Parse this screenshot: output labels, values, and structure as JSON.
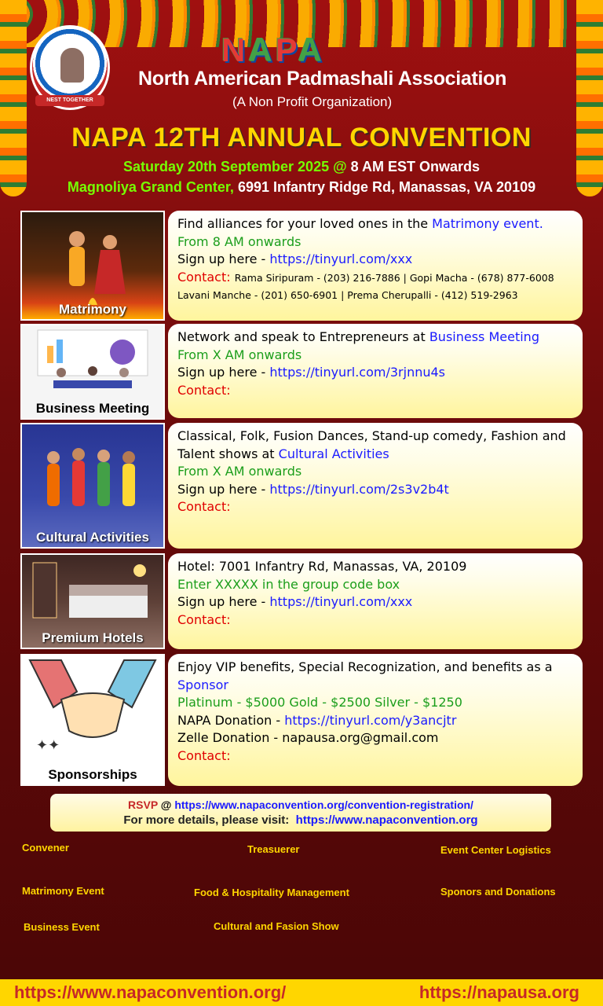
{
  "header": {
    "logo_ribbon": "NEST TOGETHER",
    "napa_letters": [
      "N",
      "A",
      "P",
      "A"
    ],
    "organization": "North American Padmashali Association",
    "subtitle": "(A Non Profit Organization)",
    "convention_title": "NAPA 12TH ANNUAL CONVENTION",
    "date_part": "Saturday 20th September 2025 @",
    "time_part": "8 AM EST Onwards",
    "venue_part": "Magnoliya Grand Center,",
    "address_part": "6991 Infantry Ridge Rd, Manassas, VA 20109"
  },
  "cards": {
    "matrimony": {
      "label": "Matrimony",
      "line1_a": "Find alliances for your loved ones in the ",
      "line1_b": "Matrimony event.",
      "line2": "From 8 AM onwards",
      "signup_a": "Sign up here - ",
      "signup_url": "https://tinyurl.com/xxx",
      "contact_label": "Contact:",
      "contact_1": "Rama Siripuram - (203) 216-7886 | Gopi Macha - (678) 877-6008",
      "contact_2": "Lavani Manche - (201) 650-6901 | Prema Cherupalli - (412) 519-2963"
    },
    "business": {
      "label": "Business Meeting",
      "line1_a": "Network and speak to Entrepreneurs at ",
      "line1_b": "Business Meeting",
      "line2": "From X AM onwards",
      "signup_a": "Sign up here - ",
      "signup_url": "https://tinyurl.com/3rjnnu4s",
      "contact_label": "Contact:"
    },
    "cultural": {
      "label": "Cultural Activities",
      "line1_a": "Classical, Folk, Fusion Dances, Stand-up comedy, Fashion and Talent shows at ",
      "line1_b": "Cultural Activities",
      "line2": "From X AM onwards",
      "signup_a": "Sign up here - ",
      "signup_url": "https://tinyurl.com/2s3v2b4t",
      "contact_label": "Contact:"
    },
    "hotels": {
      "label": "Premium Hotels",
      "line1": "Hotel: 7001 Infantry Rd, Manassas, VA, 20109",
      "line2": "Enter XXXXX in the group code box",
      "signup_a": "Sign up here - ",
      "signup_url": "https://tinyurl.com/xxx",
      "contact_label": "Contact:"
    },
    "sponsorships": {
      "label": "Sponsorships",
      "line1_a": "Enjoy VIP benefits, Special Recognization, and benefits as a ",
      "line1_b": "Sponsor",
      "tiers": "Platinum - $5000  Gold - $2500  Silver - $1250",
      "donation_a": "NAPA Donation - ",
      "donation_url": "https://tinyurl.com/y3ancjtr",
      "zelle": "Zelle Donation - napausa.org@gmail.com",
      "contact_label": "Contact:"
    }
  },
  "rsvp": {
    "label": "RSVP",
    "at": " @ ",
    "url": "https://www.napaconvention.org/convention-registration/",
    "details": "For more details, please visit:",
    "details_url": "https://www.napaconvention.org"
  },
  "roles": {
    "convener": "Convener",
    "treasurer": "Treasuerer",
    "logistics": "Event Center Logistics",
    "matrimony_event": "Matrimony Event",
    "food": "Food & Hospitality Management",
    "sponsors": "Sponors and Donations",
    "business_event": "Business Event",
    "cultural_show": "Cultural and Fasion Show"
  },
  "footer": {
    "left_url": "https://www.napaconvention.org/",
    "right_url": "https://napausa.org"
  }
}
